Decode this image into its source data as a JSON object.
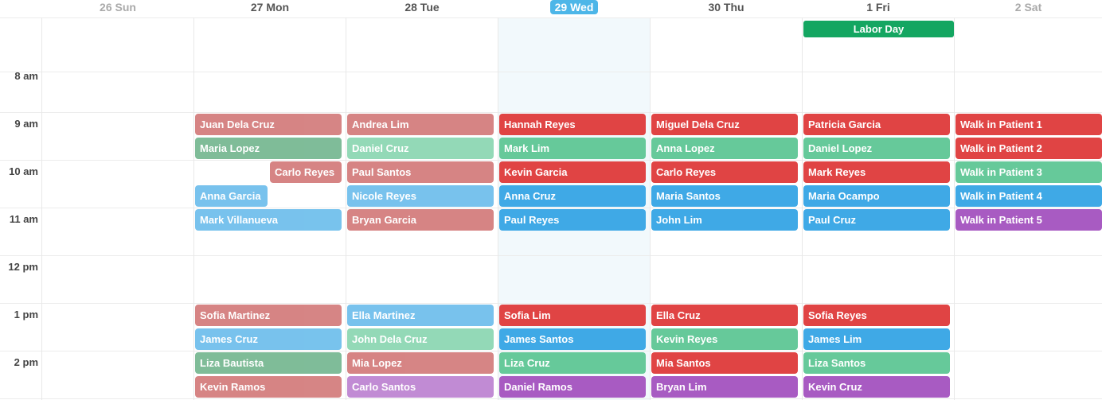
{
  "days": [
    "26 Sun",
    "27 Mon",
    "28 Tue",
    "29 Wed",
    "30 Thu",
    "1 Fri",
    "2 Sat"
  ],
  "today_index": 3,
  "all_day_events": [
    {
      "day_index": 5,
      "title": "Labor Day",
      "color": "#14a661"
    }
  ],
  "times": [
    "8 am",
    "9 am",
    "10 am",
    "11 am",
    "12 pm",
    "1 pm",
    "2 pm"
  ],
  "events": [
    {
      "day": "27 Mon",
      "title": "Juan Dela  Cruz",
      "color": "#e04444",
      "past": true
    },
    {
      "day": "27 Mon",
      "title": "Maria Lopez",
      "color": "#49a06d",
      "past": true
    },
    {
      "day": "27 Mon",
      "title": "Carlo Reyes",
      "color": "#e04444",
      "past": true
    },
    {
      "day": "27 Mon",
      "title": "Anna Garcia",
      "color": "#3fa9e6",
      "past": true
    },
    {
      "day": "27 Mon",
      "title": "Mark Villanueva",
      "color": "#3fa9e6",
      "past": true
    },
    {
      "day": "27 Mon",
      "title": "Sofia Martinez",
      "color": "#e04444",
      "past": true
    },
    {
      "day": "27 Mon",
      "title": "James Cruz",
      "color": "#3fa9e6",
      "past": true
    },
    {
      "day": "27 Mon",
      "title": "Liza Bautista",
      "color": "#49a06d",
      "past": true
    },
    {
      "day": "27 Mon",
      "title": "Kevin Ramos",
      "color": "#e04444",
      "past": true
    },
    {
      "day": "28 Tue",
      "title": "Andrea Lim",
      "color": "#e04444",
      "past": true
    },
    {
      "day": "28 Tue",
      "title": "Daniel Cruz",
      "color": "#66c99a",
      "past": true
    },
    {
      "day": "28 Tue",
      "title": "Paul Santos",
      "color": "#e04444",
      "past": true
    },
    {
      "day": "28 Tue",
      "title": "Nicole Reyes",
      "color": "#3fa9e6",
      "past": true
    },
    {
      "day": "28 Tue",
      "title": "Bryan Garcia",
      "color": "#e04444",
      "past": true
    },
    {
      "day": "28 Tue",
      "title": "Ella Martinez",
      "color": "#3fa9e6",
      "past": true
    },
    {
      "day": "28 Tue",
      "title": "John Dela Cruz",
      "color": "#66c99a",
      "past": true
    },
    {
      "day": "28 Tue",
      "title": "Mia Lopez",
      "color": "#e04444",
      "past": true
    },
    {
      "day": "28 Tue",
      "title": "Carlo Santos",
      "color": "#a85bc2",
      "past": true
    },
    {
      "day": "29 Wed",
      "title": "Hannah Reyes",
      "color": "#e04444"
    },
    {
      "day": "29 Wed",
      "title": "Mark Lim",
      "color": "#66c99a"
    },
    {
      "day": "29 Wed",
      "title": "Kevin Garcia",
      "color": "#e04444"
    },
    {
      "day": "29 Wed",
      "title": "Anna Cruz",
      "color": "#3fa9e6"
    },
    {
      "day": "29 Wed",
      "title": "Paul Reyes",
      "color": "#3fa9e6"
    },
    {
      "day": "29 Wed",
      "title": "Sofia Lim",
      "color": "#e04444"
    },
    {
      "day": "29 Wed",
      "title": "James Santos",
      "color": "#3fa9e6"
    },
    {
      "day": "29 Wed",
      "title": "Liza Cruz",
      "color": "#66c99a"
    },
    {
      "day": "29 Wed",
      "title": "Daniel Ramos",
      "color": "#a85bc2"
    },
    {
      "day": "30 Thu",
      "title": "Miguel Dela Cruz",
      "color": "#e04444"
    },
    {
      "day": "30 Thu",
      "title": "Anna Lopez",
      "color": "#66c99a"
    },
    {
      "day": "30 Thu",
      "title": "Carlo Reyes",
      "color": "#e04444"
    },
    {
      "day": "30 Thu",
      "title": "Maria Santos",
      "color": "#3fa9e6"
    },
    {
      "day": "30 Thu",
      "title": "John Lim",
      "color": "#3fa9e6"
    },
    {
      "day": "30 Thu",
      "title": "Ella Cruz",
      "color": "#e04444"
    },
    {
      "day": "30 Thu",
      "title": "Kevin Reyes",
      "color": "#66c99a"
    },
    {
      "day": "30 Thu",
      "title": "Mia Santos",
      "color": "#e04444"
    },
    {
      "day": "30 Thu",
      "title": "Bryan Lim",
      "color": "#a85bc2"
    },
    {
      "day": "1 Fri",
      "title": "Patricia Garcia",
      "color": "#e04444"
    },
    {
      "day": "1 Fri",
      "title": "Daniel Lopez",
      "color": "#66c99a"
    },
    {
      "day": "1 Fri",
      "title": "Mark Reyes",
      "color": "#e04444"
    },
    {
      "day": "1 Fri",
      "title": "Maria Ocampo",
      "color": "#3fa9e6"
    },
    {
      "day": "1 Fri",
      "title": "Paul Cruz",
      "color": "#3fa9e6"
    },
    {
      "day": "1 Fri",
      "title": "Sofia Reyes",
      "color": "#e04444"
    },
    {
      "day": "1 Fri",
      "title": "James Lim",
      "color": "#3fa9e6"
    },
    {
      "day": "1 Fri",
      "title": "Liza Santos",
      "color": "#66c99a"
    },
    {
      "day": "1 Fri",
      "title": "Kevin Cruz",
      "color": "#a85bc2"
    },
    {
      "day": "2 Sat",
      "title": "Walk in Patient 1",
      "color": "#e04444"
    },
    {
      "day": "2 Sat",
      "title": "Walk in Patient 2",
      "color": "#e04444"
    },
    {
      "day": "2 Sat",
      "title": "Walk in Patient 3",
      "color": "#66c99a"
    },
    {
      "day": "2 Sat",
      "title": "Walk in Patient 4",
      "color": "#3fa9e6"
    },
    {
      "day": "2 Sat",
      "title": "Walk in Patient 5",
      "color": "#a85bc2"
    }
  ]
}
